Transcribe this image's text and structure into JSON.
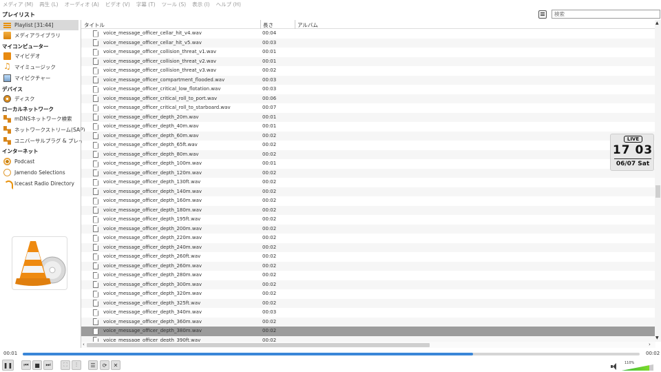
{
  "menubar": [
    "メディア (M)",
    "再生 (L)",
    "オーディオ (A)",
    "ビデオ (V)",
    "字幕 (T)",
    "ツール (S)",
    "表示 (I)",
    "ヘルプ (H)"
  ],
  "sidebar": {
    "header": "プレイリスト",
    "playlist_item": "Playlist [31:44]",
    "media_library": "メディアライブラリ",
    "my_computer": "マイコンピューター",
    "my_videos": "マイビデオ",
    "my_music": "マイミュージック",
    "my_pictures": "マイピクチャー",
    "devices": "デバイス",
    "disc": "ディスク",
    "local_network": "ローカルネットワーク",
    "mdns": "mDNSネットワーク検索",
    "sap": "ネットワークストリーム(SAP)",
    "upnp": "ユニバーサルプラグ & プレイ",
    "internet": "インターネット",
    "podcast": "Podcast",
    "jamendo": "Jamendo Selections",
    "icecast": "Icecast Radio Directory"
  },
  "search": {
    "placeholder": "検索"
  },
  "table": {
    "columns": {
      "title": "タイトル",
      "duration": "長さ",
      "album": "アルバム"
    },
    "rows": [
      {
        "title": "voice_message_officer_cellar_hit_v4.wav",
        "duration": "00:04"
      },
      {
        "title": "voice_message_officer_cellar_hit_v5.wav",
        "duration": "00:03"
      },
      {
        "title": "voice_message_officer_collision_threat_v1.wav",
        "duration": "00:01"
      },
      {
        "title": "voice_message_officer_collision_threat_v2.wav",
        "duration": "00:01"
      },
      {
        "title": "voice_message_officer_collision_threat_v3.wav",
        "duration": "00:02"
      },
      {
        "title": "voice_message_officer_compartment_flooded.wav",
        "duration": "00:03"
      },
      {
        "title": "voice_message_officer_critical_low_flotation.wav",
        "duration": "00:03"
      },
      {
        "title": "voice_message_officer_critical_roll_to_port.wav",
        "duration": "00:06"
      },
      {
        "title": "voice_message_officer_critical_roll_to_starboard.wav",
        "duration": "00:07"
      },
      {
        "title": "voice_message_officer_depth_20m.wav",
        "duration": "00:01"
      },
      {
        "title": "voice_message_officer_depth_40m.wav",
        "duration": "00:01"
      },
      {
        "title": "voice_message_officer_depth_60m.wav",
        "duration": "00:02"
      },
      {
        "title": "voice_message_officer_depth_65ft.wav",
        "duration": "00:02"
      },
      {
        "title": "voice_message_officer_depth_80m.wav",
        "duration": "00:02"
      },
      {
        "title": "voice_message_officer_depth_100m.wav",
        "duration": "00:01"
      },
      {
        "title": "voice_message_officer_depth_120m.wav",
        "duration": "00:02"
      },
      {
        "title": "voice_message_officer_depth_130ft.wav",
        "duration": "00:02"
      },
      {
        "title": "voice_message_officer_depth_140m.wav",
        "duration": "00:02"
      },
      {
        "title": "voice_message_officer_depth_160m.wav",
        "duration": "00:02"
      },
      {
        "title": "voice_message_officer_depth_180m.wav",
        "duration": "00:02"
      },
      {
        "title": "voice_message_officer_depth_195ft.wav",
        "duration": "00:02"
      },
      {
        "title": "voice_message_officer_depth_200m.wav",
        "duration": "00:02"
      },
      {
        "title": "voice_message_officer_depth_220m.wav",
        "duration": "00:02"
      },
      {
        "title": "voice_message_officer_depth_240m.wav",
        "duration": "00:02"
      },
      {
        "title": "voice_message_officer_depth_260ft.wav",
        "duration": "00:02"
      },
      {
        "title": "voice_message_officer_depth_260m.wav",
        "duration": "00:02"
      },
      {
        "title": "voice_message_officer_depth_280m.wav",
        "duration": "00:02"
      },
      {
        "title": "voice_message_officer_depth_300m.wav",
        "duration": "00:02"
      },
      {
        "title": "voice_message_officer_depth_320m.wav",
        "duration": "00:02"
      },
      {
        "title": "voice_message_officer_depth_325ft.wav",
        "duration": "00:02"
      },
      {
        "title": "voice_message_officer_depth_340m.wav",
        "duration": "00:03"
      },
      {
        "title": "voice_message_officer_depth_360m.wav",
        "duration": "00:02"
      },
      {
        "title": "voice_message_officer_depth_380m.wav",
        "duration": "00:02"
      },
      {
        "title": "voice_message_officer_depth_390ft.wav",
        "duration": "00:02"
      }
    ],
    "selected_index": 32
  },
  "clock": {
    "badge": "LIVE",
    "time": "17 03",
    "date": "06/07 Sat"
  },
  "player": {
    "elapsed": "00:01",
    "total": "00:02",
    "progress_fraction": 0.73,
    "volume_label": "110%",
    "volume_fraction": 0.88
  },
  "colors": {
    "accent": "#3a86d8",
    "selected_row": "#9c9c9c",
    "vlc_orange": "#e8910c"
  }
}
